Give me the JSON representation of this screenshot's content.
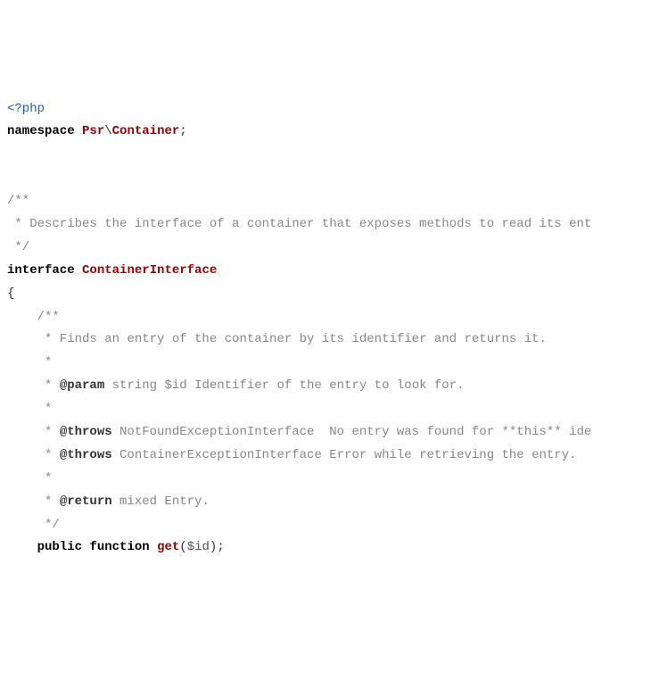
{
  "code": {
    "opentag": "<?php",
    "ns_kw": "namespace",
    "ns_part1": "Psr",
    "ns_sep": "\\",
    "ns_part2": "Container",
    "semicolon": ";",
    "cblk_open": "/**",
    "cblk_line1": " * Describes the interface of a container that exposes methods to read its ent",
    "cblk_close": " */",
    "iface_kw": "interface",
    "iface_name": "ContainerInterface",
    "brace_open": "{",
    "m_cblk_open": "    /**",
    "m_line1": "     * Finds an entry of the container by its identifier and returns it.",
    "m_star": "     *",
    "m_param_pre": "     * ",
    "m_param_tag": "@param",
    "m_param_rest": " string $id Identifier of the entry to look for.",
    "m_throws_pre": "     * ",
    "m_throws_tag": "@throws",
    "m_throws1_rest": " NotFoundExceptionInterface  No entry was found for **this** ide",
    "m_throws2_rest": " ContainerExceptionInterface Error while retrieving the entry.",
    "m_return_tag": "@return",
    "m_return_rest": " mixed Entry.",
    "m_cblk_close": "     */",
    "method_indent": "    ",
    "method_public": "public",
    "method_function": "function",
    "method_name": "get",
    "method_paren_open": "(",
    "method_var": "$id",
    "method_paren_close": ")",
    "method_semi": ";"
  }
}
